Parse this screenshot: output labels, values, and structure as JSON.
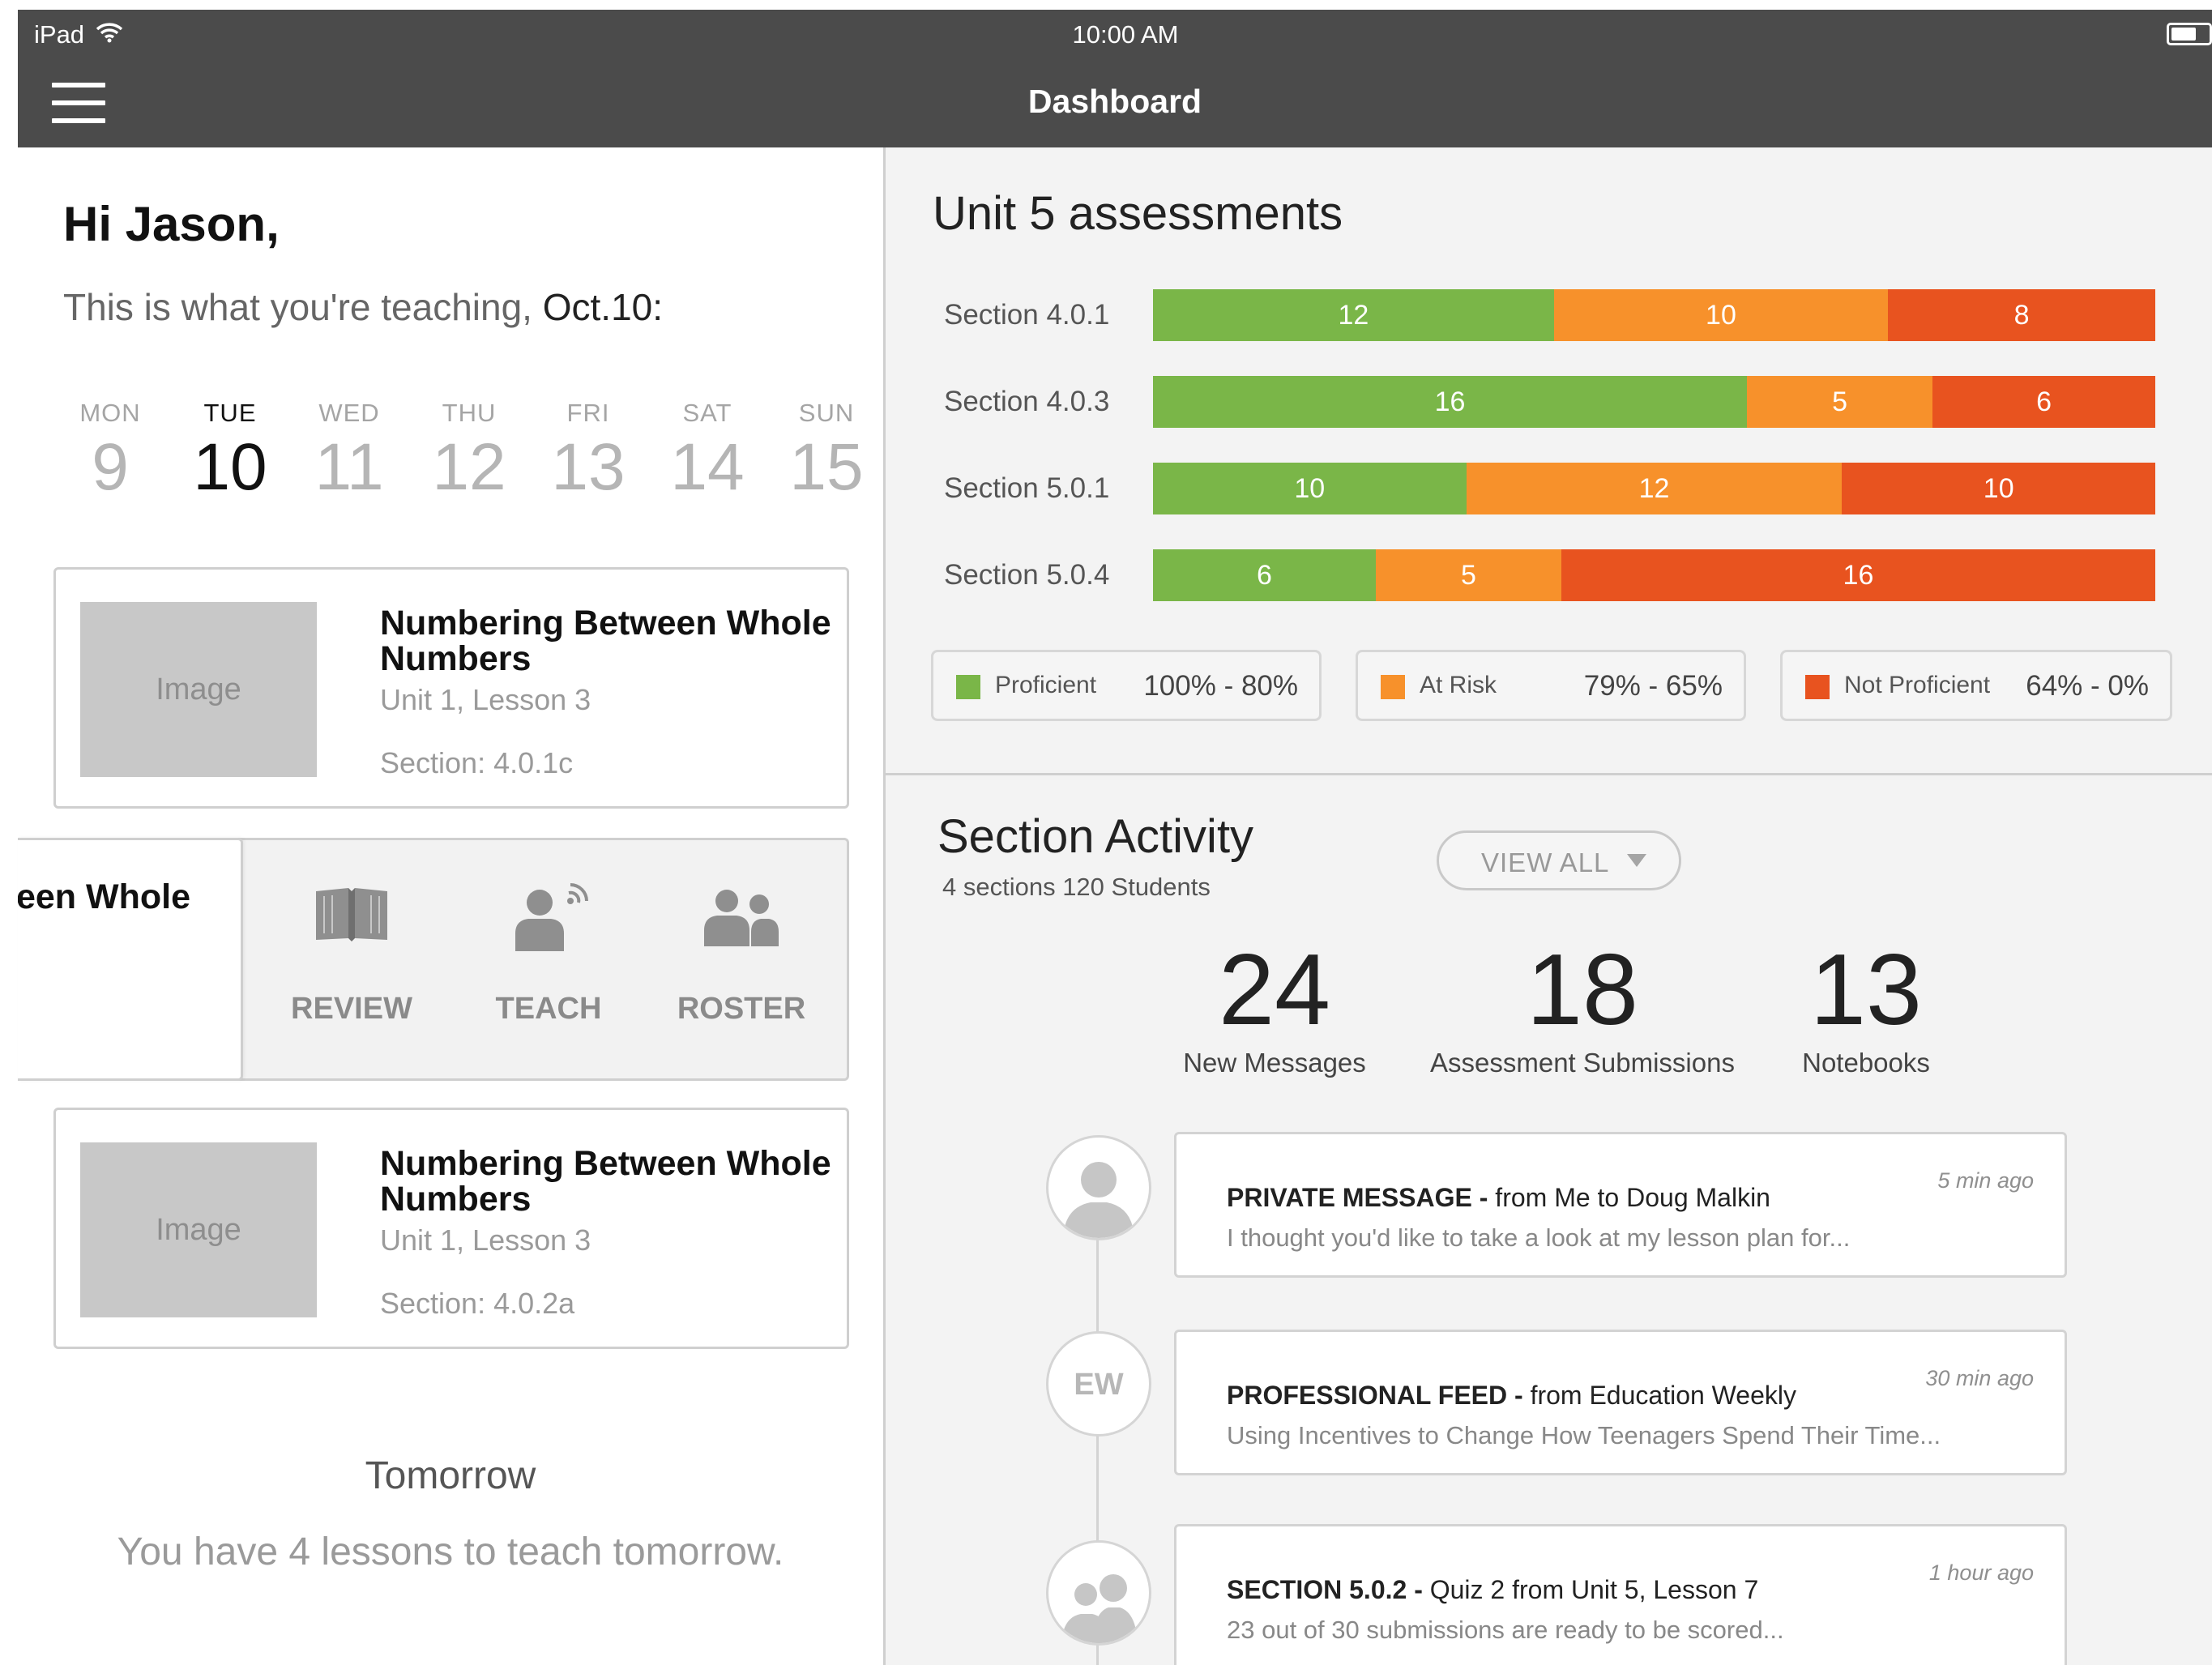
{
  "status_bar": {
    "carrier": "iPad",
    "time": "10:00 AM"
  },
  "nav": {
    "title": "Dashboard"
  },
  "greeting": {
    "hello": "Hi Jason,",
    "subtitle_prefix": "This is what you're teaching, ",
    "subtitle_date": "Oct.10:"
  },
  "week": [
    {
      "name": "MON",
      "num": "9"
    },
    {
      "name": "TUE",
      "num": "10"
    },
    {
      "name": "WED",
      "num": "11"
    },
    {
      "name": "THU",
      "num": "12"
    },
    {
      "name": "FRI",
      "num": "13"
    },
    {
      "name": "SAT",
      "num": "14"
    },
    {
      "name": "SUN",
      "num": "15"
    }
  ],
  "lessons": [
    {
      "image_label": "Image",
      "title": "Numbering Between Whole Numbers",
      "unit": "Unit 1, Lesson 3",
      "section": "Section: 4.0.1c"
    },
    {
      "image_label": "Image",
      "title": "Numbering Between Whole Numbers",
      "unit": "Unit 1, Lesson 3",
      "section": "Section: 4.0.2a"
    }
  ],
  "slid_card": {
    "title": "een Whole"
  },
  "actions": {
    "review": "REVIEW",
    "teach": "TEACH",
    "roster": "ROSTER"
  },
  "tomorrow": {
    "heading": "Tomorrow",
    "message": "You have 4 lessons to teach tomorrow."
  },
  "assessments": {
    "title": "Unit 5 assessments",
    "legend": [
      {
        "name": "Proficient",
        "range": "100% - 80%",
        "color": "#7ab648"
      },
      {
        "name": "At Risk",
        "range": "79% - 65%",
        "color": "#f7912b"
      },
      {
        "name": "Not Proficient",
        "range": "64% - 0%",
        "color": "#e8531f"
      }
    ]
  },
  "chart_data": {
    "type": "bar",
    "stacked": true,
    "orientation": "horizontal",
    "title": "Unit 5 assessments",
    "categories": [
      "Section 4.0.1",
      "Section 4.0.3",
      "Section 5.0.1",
      "Section 5.0.4"
    ],
    "series": [
      {
        "name": "Proficient",
        "values": [
          12,
          16,
          10,
          6
        ],
        "color": "#7ab648"
      },
      {
        "name": "At Risk",
        "values": [
          10,
          5,
          12,
          5
        ],
        "color": "#f7912b"
      },
      {
        "name": "Not Proficient",
        "values": [
          8,
          6,
          10,
          16
        ],
        "color": "#e8531f"
      }
    ],
    "legend": "bottom",
    "grid": false
  },
  "activity": {
    "title": "Section Activity",
    "meta": "4 sections 120 Students",
    "view_all": "VIEW ALL",
    "stats": [
      {
        "value": "24",
        "label": "New Messages"
      },
      {
        "value": "18",
        "label": "Assessment Submissions"
      },
      {
        "value": "13",
        "label": "Notebooks"
      }
    ],
    "feed": [
      {
        "avatar": "person",
        "tag": "PRIVATE MESSAGE - ",
        "from": "from Me to Doug Malkin",
        "snippet": "I thought you'd like to take a look at my lesson plan for...",
        "when": "5 min ago"
      },
      {
        "avatar": "EW",
        "tag": "PROFESSIONAL FEED - ",
        "from": "from Education Weekly",
        "snippet": "Using Incentives to Change How Teenagers Spend Their Time...",
        "when": "30 min ago"
      },
      {
        "avatar": "group",
        "tag": "SECTION 5.0.2 - ",
        "from": "Quiz 2 from Unit 5, Lesson 7",
        "snippet": "23 out of 30 submissions are ready to be scored...",
        "when": "1 hour ago"
      }
    ]
  }
}
